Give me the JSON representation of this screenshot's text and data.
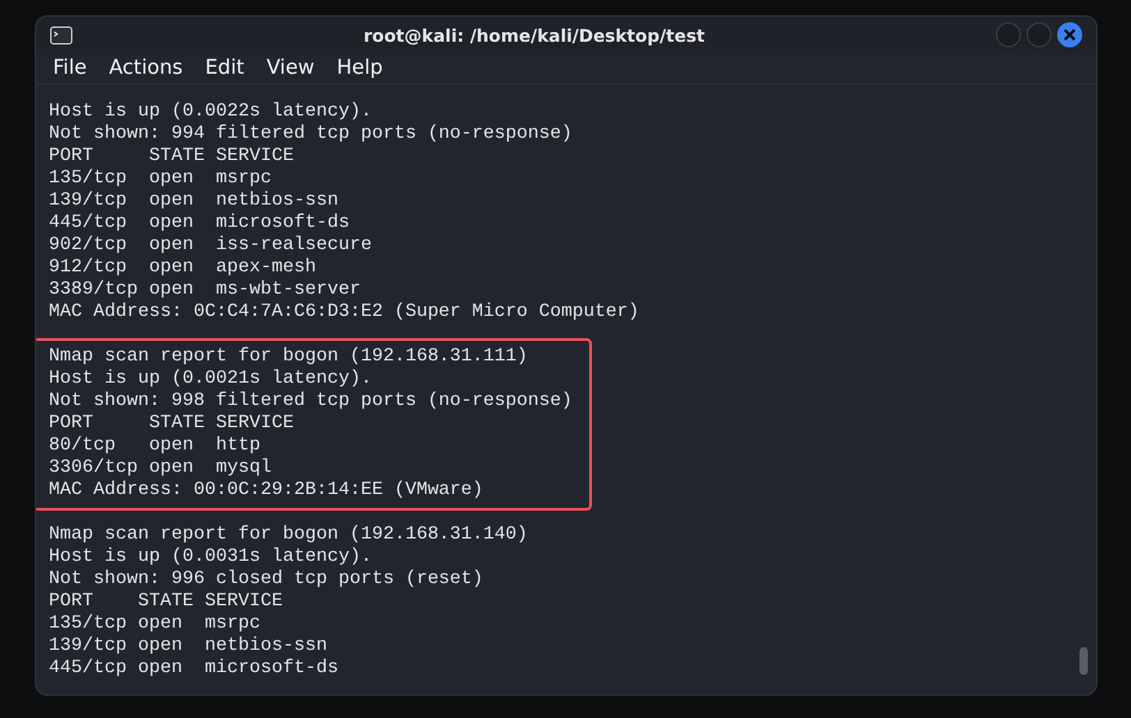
{
  "window": {
    "title": "root@kali: /home/kali/Desktop/test"
  },
  "menu": [
    "File",
    "Actions",
    "Edit",
    "View",
    "Help"
  ],
  "terminal": {
    "blocks": [
      {
        "highlighted": false,
        "lines": [
          "Host is up (0.0022s latency).",
          "Not shown: 994 filtered tcp ports (no-response)",
          "PORT     STATE SERVICE",
          "135/tcp  open  msrpc",
          "139/tcp  open  netbios-ssn",
          "445/tcp  open  microsoft-ds",
          "902/tcp  open  iss-realsecure",
          "912/tcp  open  apex-mesh",
          "3389/tcp open  ms-wbt-server",
          "MAC Address: 0C:C4:7A:C6:D3:E2 (Super Micro Computer)"
        ]
      },
      {
        "highlighted": true,
        "lines": [
          "Nmap scan report for bogon (192.168.31.111)",
          "Host is up (0.0021s latency).",
          "Not shown: 998 filtered tcp ports (no-response)",
          "PORT     STATE SERVICE",
          "80/tcp   open  http",
          "3306/tcp open  mysql",
          "MAC Address: 00:0C:29:2B:14:EE (VMware)"
        ]
      },
      {
        "highlighted": false,
        "lines": [
          "Nmap scan report for bogon (192.168.31.140)",
          "Host is up (0.0031s latency).",
          "Not shown: 996 closed tcp ports (reset)",
          "PORT    STATE SERVICE",
          "135/tcp open  msrpc",
          "139/tcp open  netbios-ssn",
          "445/tcp open  microsoft-ds"
        ]
      }
    ]
  }
}
